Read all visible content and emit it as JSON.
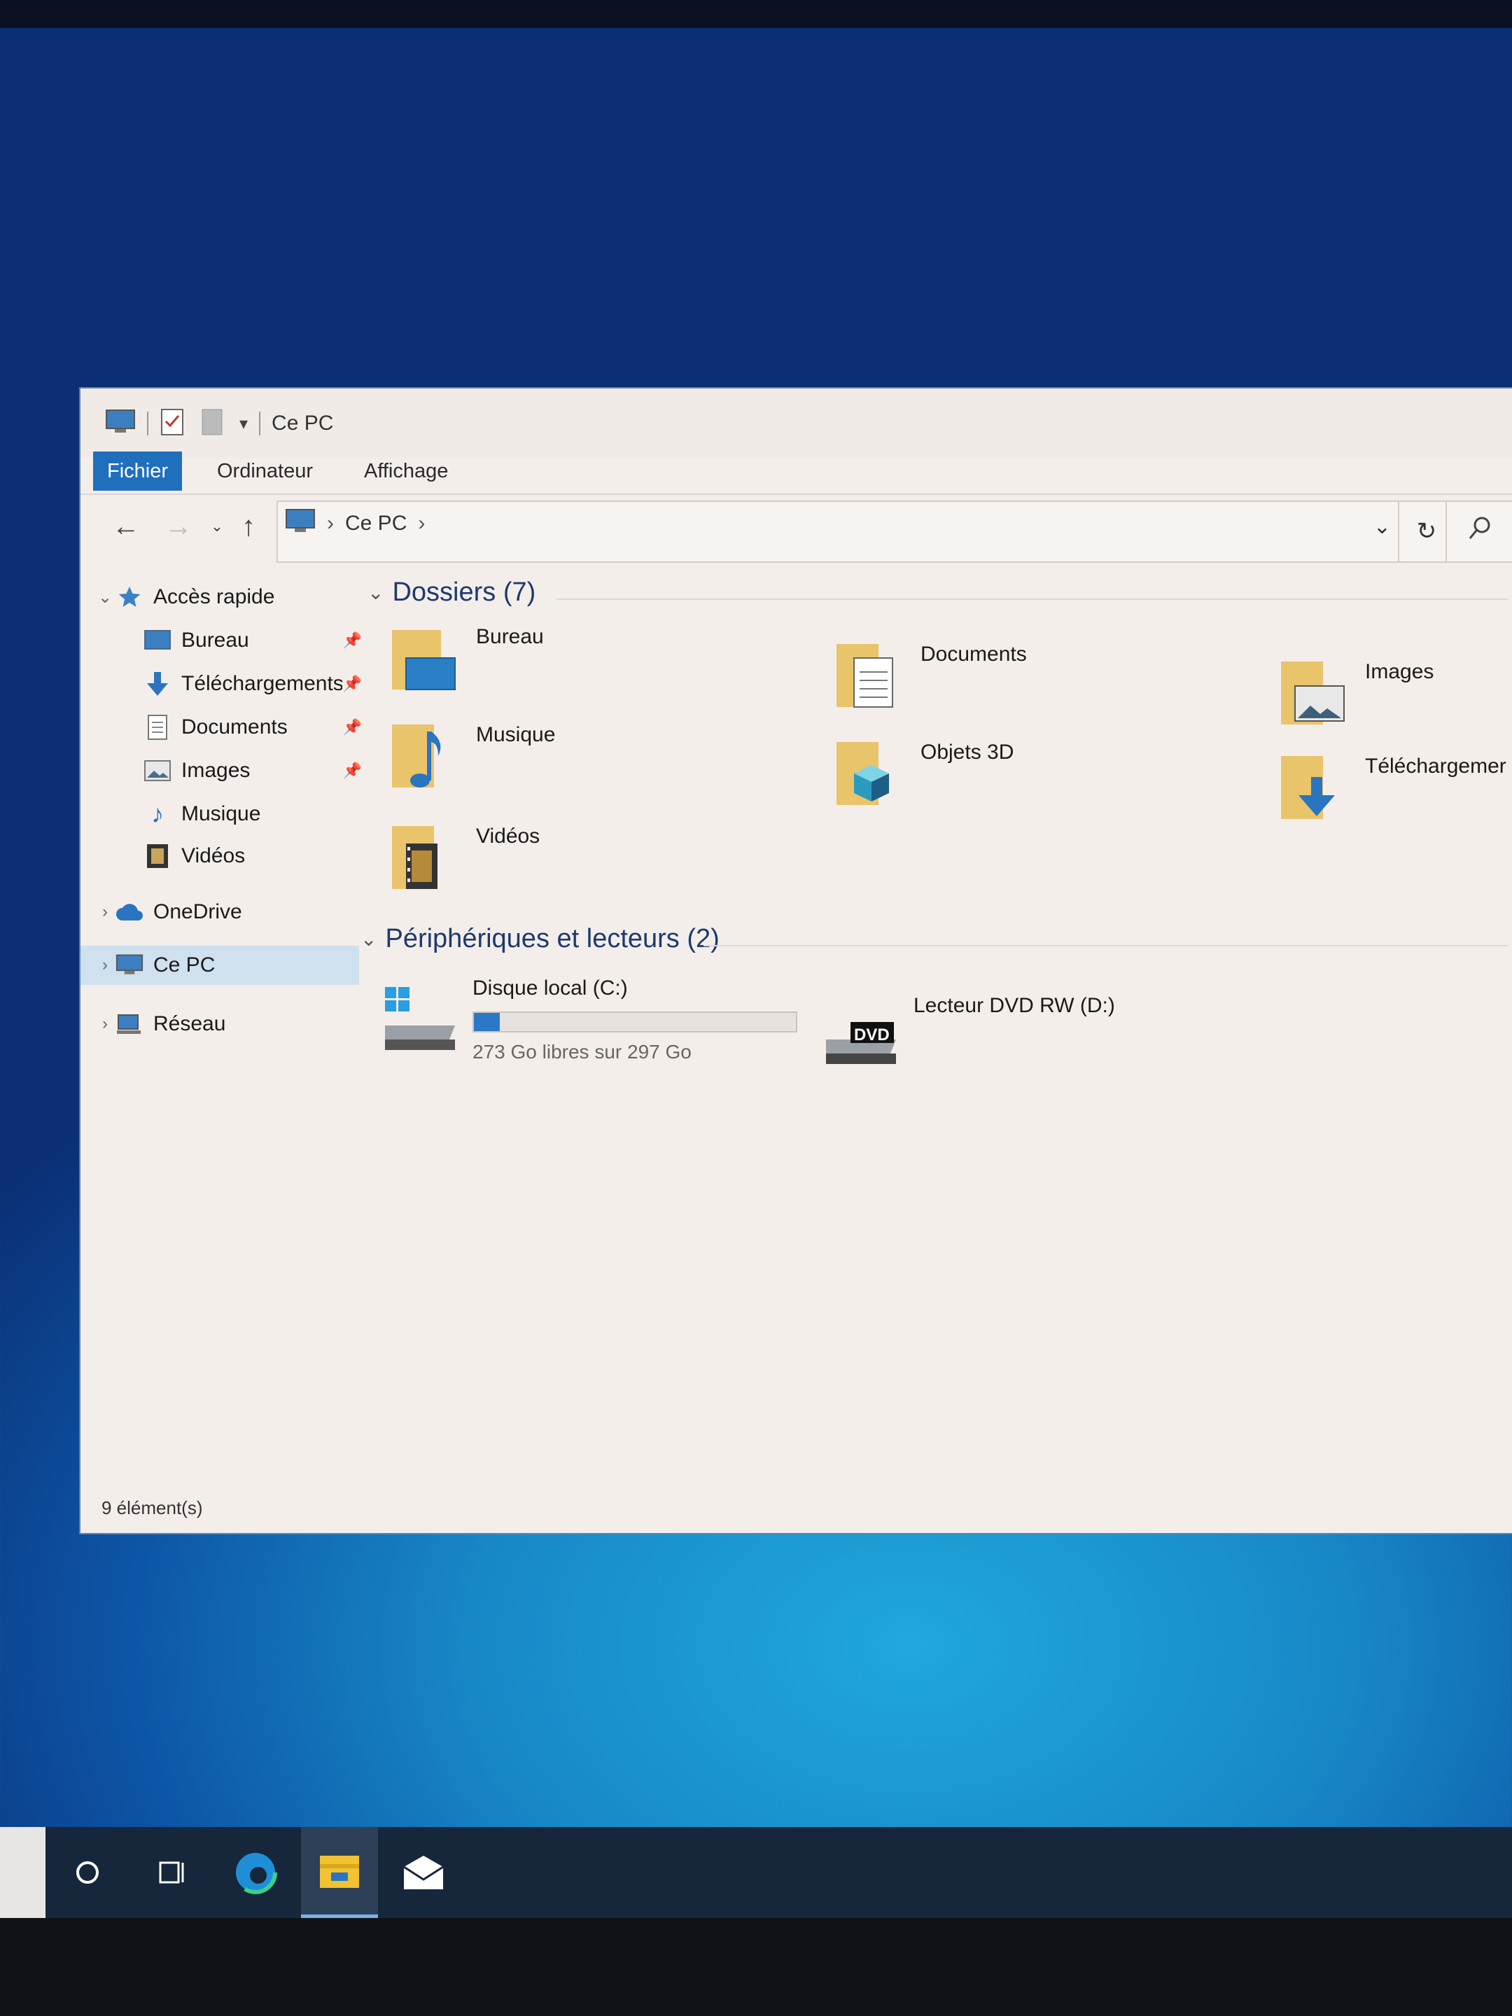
{
  "window": {
    "title": "Ce PC",
    "tabs": [
      "Fichier",
      "Ordinateur",
      "Affichage"
    ],
    "address": {
      "path_label": "Ce PC",
      "separator": "›"
    }
  },
  "sidebar": {
    "items": [
      {
        "label": "Accès rapide",
        "icon": "star-icon"
      },
      {
        "label": "Bureau",
        "icon": "desktop-icon",
        "pinned": true
      },
      {
        "label": "Téléchargements",
        "icon": "download-icon",
        "pinned": true
      },
      {
        "label": "Documents",
        "icon": "document-icon",
        "pinned": true
      },
      {
        "label": "Images",
        "icon": "picture-icon",
        "pinned": true
      },
      {
        "label": "Musique",
        "icon": "music-icon"
      },
      {
        "label": "Vidéos",
        "icon": "video-icon"
      },
      {
        "label": "OneDrive",
        "icon": "cloud-icon"
      },
      {
        "label": "Ce PC",
        "icon": "computer-icon",
        "selected": true
      },
      {
        "label": "Réseau",
        "icon": "network-icon"
      }
    ]
  },
  "content": {
    "folders_header": "Dossiers (7)",
    "folders": [
      {
        "label": "Bureau"
      },
      {
        "label": "Documents"
      },
      {
        "label": "Images"
      },
      {
        "label": "Musique"
      },
      {
        "label": "Objets 3D"
      },
      {
        "label": "Téléchargemer"
      },
      {
        "label": "Vidéos"
      }
    ],
    "devices_header": "Périphériques et lecteurs (2)",
    "drives": [
      {
        "label": "Disque local (C:)",
        "free_text": "273 Go libres sur 297 Go",
        "used_fraction": 0.08
      },
      {
        "label": "Lecteur DVD RW (D:)",
        "badge": "DVD"
      }
    ]
  },
  "status": {
    "count": "9 élément(s)"
  },
  "taskbar": {
    "icons": [
      "search-circle-icon",
      "task-view-icon",
      "edge-icon",
      "file-explorer-icon",
      "mail-icon"
    ]
  },
  "colors": {
    "accent": "#1f6fbd",
    "folder": "#e9c46a",
    "desktop_blue": "#1787c6"
  }
}
